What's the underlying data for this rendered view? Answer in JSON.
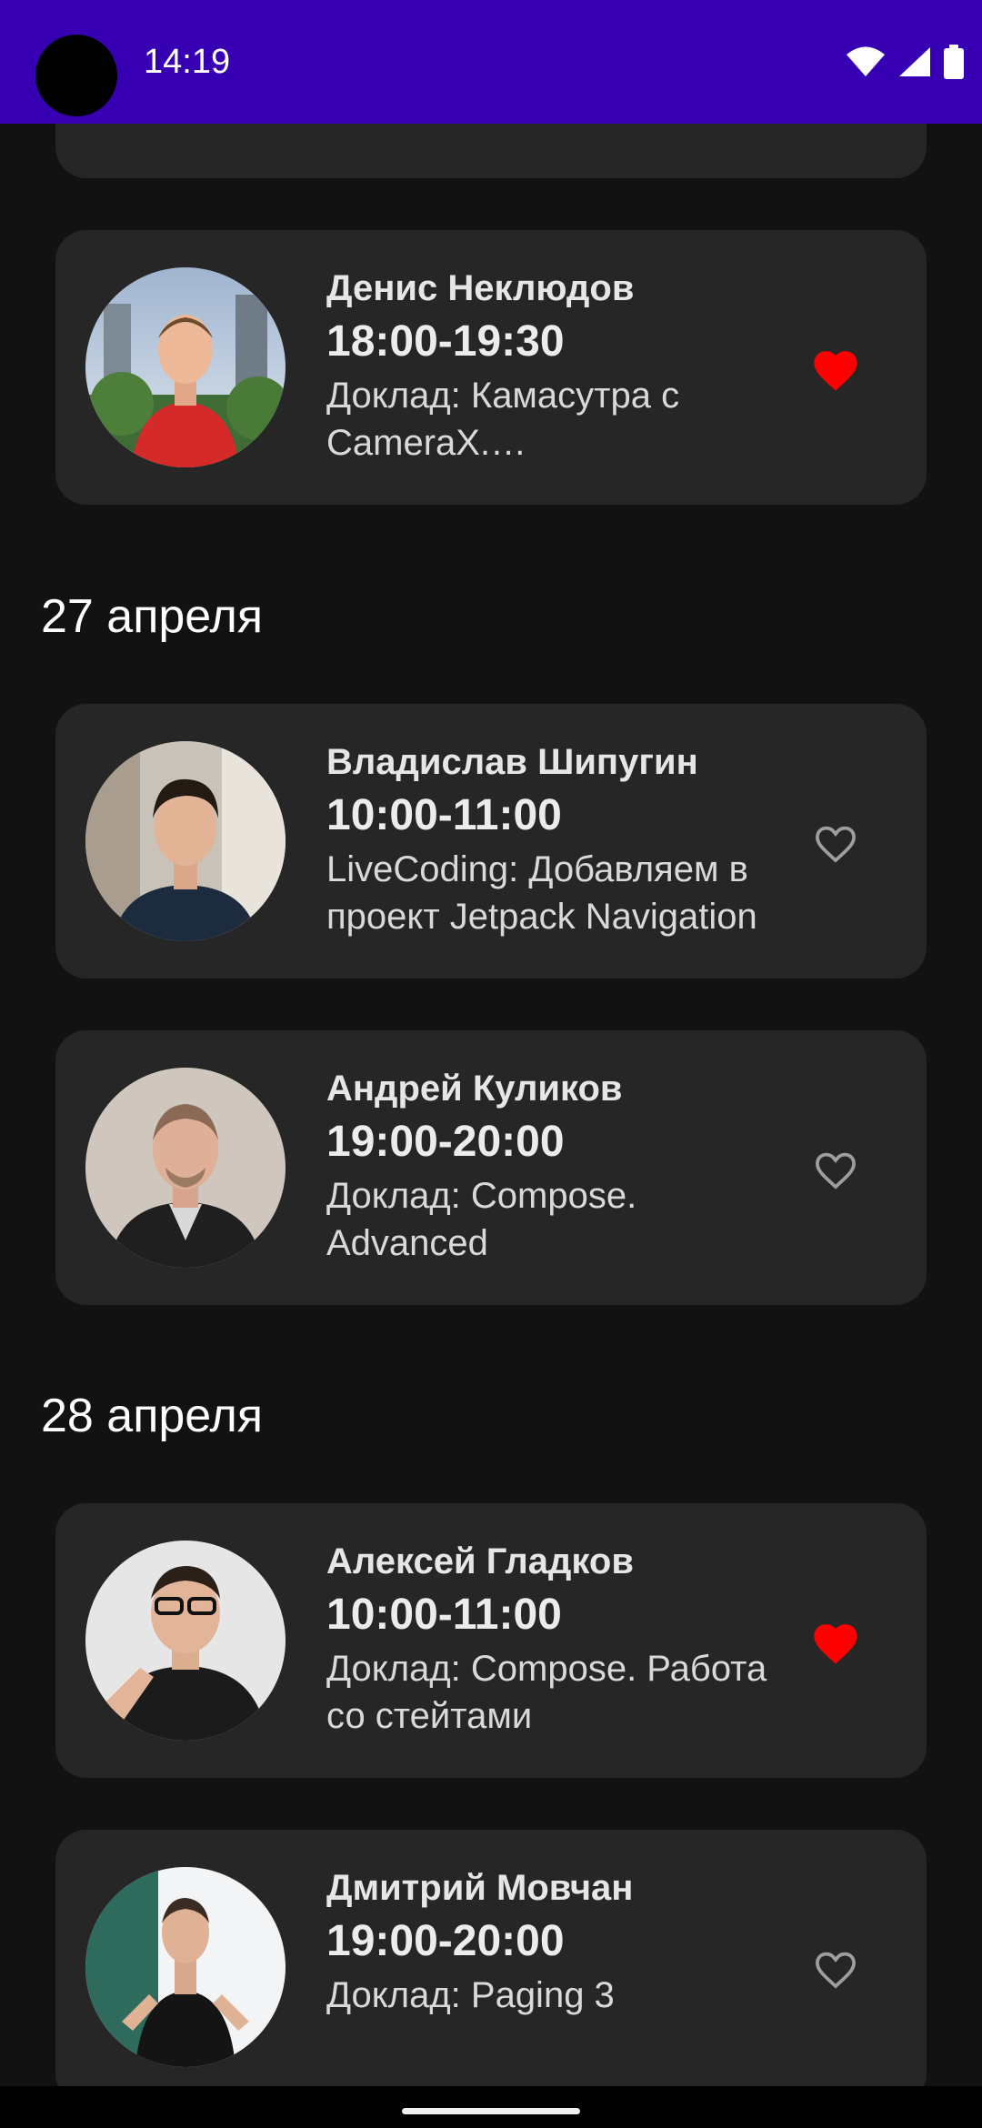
{
  "status_bar": {
    "time": "14:19"
  },
  "days": [
    {
      "date": "27 апреля"
    },
    {
      "date": "28 апреля"
    }
  ],
  "sessions": [
    {
      "speaker": "Денис Неклюдов",
      "time": "18:00-19:30",
      "talk": "Доклад: Камасутра с CameraX. Распознавание...",
      "favorite": true
    },
    {
      "speaker": "Владислав Шипугин",
      "time": "10:00-11:00",
      "talk": "LiveCoding: Добавляем в проект Jetpack Navigation",
      "favorite": false
    },
    {
      "speaker": "Андрей Куликов",
      "time": "19:00-20:00",
      "talk": "Доклад: Compose. Advanced",
      "favorite": false
    },
    {
      "speaker": "Алексей Гладков",
      "time": "10:00-11:00",
      "talk": "Доклад: Compose. Работа со стейтами",
      "favorite": true
    },
    {
      "speaker": "Дмитрий Мовчан",
      "time": "19:00-20:00",
      "talk": "Доклад: Paging 3",
      "favorite": false
    }
  ],
  "colors": {
    "status_bar": "#3700B3",
    "background": "#121212",
    "card": "#262626",
    "favorite_active": "#FF0000",
    "favorite_inactive": "#9E9E9E"
  },
  "icons": {
    "wifi": "wifi-icon",
    "signal": "signal-icon",
    "battery": "battery-icon",
    "favorite_filled": "heart-filled-icon",
    "favorite_outline": "heart-outline-icon"
  }
}
